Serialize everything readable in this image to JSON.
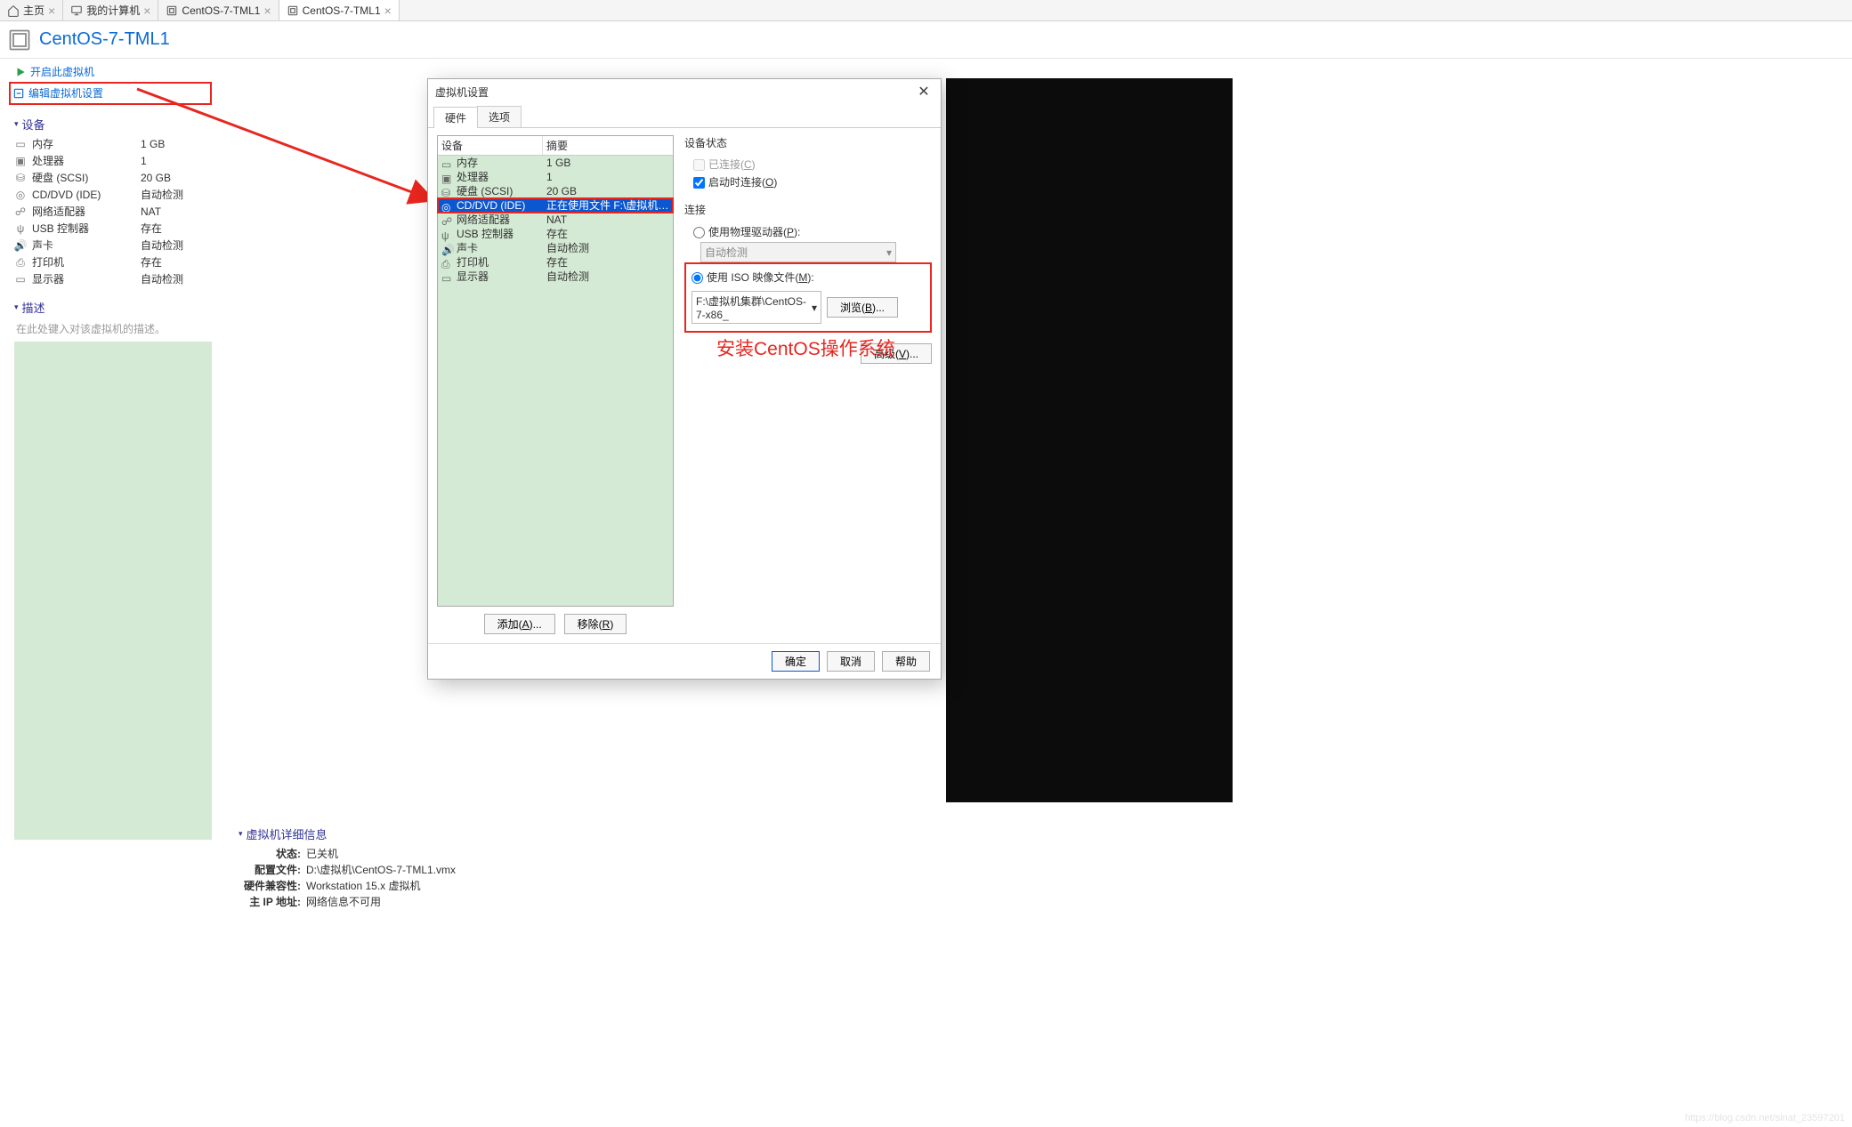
{
  "tabs": [
    {
      "label": "主页",
      "icon": "home"
    },
    {
      "label": "我的计算机",
      "icon": "monitor"
    },
    {
      "label": "CentOS-7-TML1",
      "icon": "vm"
    },
    {
      "label": "CentOS-7-TML1",
      "icon": "vm",
      "active": true
    }
  ],
  "vm_title": "CentOS-7-TML1",
  "actions": {
    "power_on": "开启此虚拟机",
    "edit_settings": "编辑虚拟机设置"
  },
  "sections": {
    "devices": "设备",
    "description": "描述"
  },
  "devices": [
    {
      "icon": "memory",
      "name": "内存",
      "value": "1 GB"
    },
    {
      "icon": "cpu",
      "name": "处理器",
      "value": "1"
    },
    {
      "icon": "disk",
      "name": "硬盘 (SCSI)",
      "value": "20 GB"
    },
    {
      "icon": "cd",
      "name": "CD/DVD (IDE)",
      "value": "自动检测"
    },
    {
      "icon": "net",
      "name": "网络适配器",
      "value": "NAT"
    },
    {
      "icon": "usb",
      "name": "USB 控制器",
      "value": "存在"
    },
    {
      "icon": "sound",
      "name": "声卡",
      "value": "自动检测"
    },
    {
      "icon": "printer",
      "name": "打印机",
      "value": "存在"
    },
    {
      "icon": "display",
      "name": "显示器",
      "value": "自动检测"
    }
  ],
  "desc_placeholder": "在此处键入对该虚拟机的描述。",
  "vm_details": {
    "header": "虚拟机详细信息",
    "rows": [
      {
        "k": "状态:",
        "v": "已关机"
      },
      {
        "k": "配置文件:",
        "v": "D:\\虚拟机\\CentOS-7-TML1.vmx"
      },
      {
        "k": "硬件兼容性:",
        "v": "Workstation 15.x 虚拟机"
      },
      {
        "k": "主 IP 地址:",
        "v": "网络信息不可用"
      }
    ]
  },
  "dialog": {
    "title": "虚拟机设置",
    "tabs": {
      "hardware": "硬件",
      "options": "选项"
    },
    "hw_headers": {
      "device": "设备",
      "summary": "摘要"
    },
    "hw_rows": [
      {
        "icon": "memory",
        "name": "内存",
        "summary": "1 GB"
      },
      {
        "icon": "cpu",
        "name": "处理器",
        "summary": "1"
      },
      {
        "icon": "disk",
        "name": "硬盘 (SCSI)",
        "summary": "20 GB"
      },
      {
        "icon": "cd",
        "name": "CD/DVD (IDE)",
        "summary": "正在使用文件 F:\\虚拟机集群...",
        "selected": true
      },
      {
        "icon": "net",
        "name": "网络适配器",
        "summary": "NAT"
      },
      {
        "icon": "usb",
        "name": "USB 控制器",
        "summary": "存在"
      },
      {
        "icon": "sound",
        "name": "声卡",
        "summary": "自动检测"
      },
      {
        "icon": "printer",
        "name": "打印机",
        "summary": "存在"
      },
      {
        "icon": "display",
        "name": "显示器",
        "summary": "自动检测"
      }
    ],
    "add_btn": "添加(A)...",
    "remove_btn": "移除(R)",
    "status": {
      "title": "设备状态",
      "connected": "已连接(C)",
      "connect_on": "启动时连接(O)"
    },
    "connection": {
      "title": "连接",
      "physical": "使用物理驱动器(P):",
      "physical_value": "自动检测",
      "iso": "使用 ISO 映像文件(M):",
      "iso_value": "F:\\虚拟机集群\\CentOS-7-x86_",
      "browse": "浏览(B)..."
    },
    "advanced": "高级(V)...",
    "footer": {
      "ok": "确定",
      "cancel": "取消",
      "help": "帮助"
    }
  },
  "annotation": "安装CentOS操作系统",
  "watermark": "https://blog.csdn.net/sinat_23597201"
}
